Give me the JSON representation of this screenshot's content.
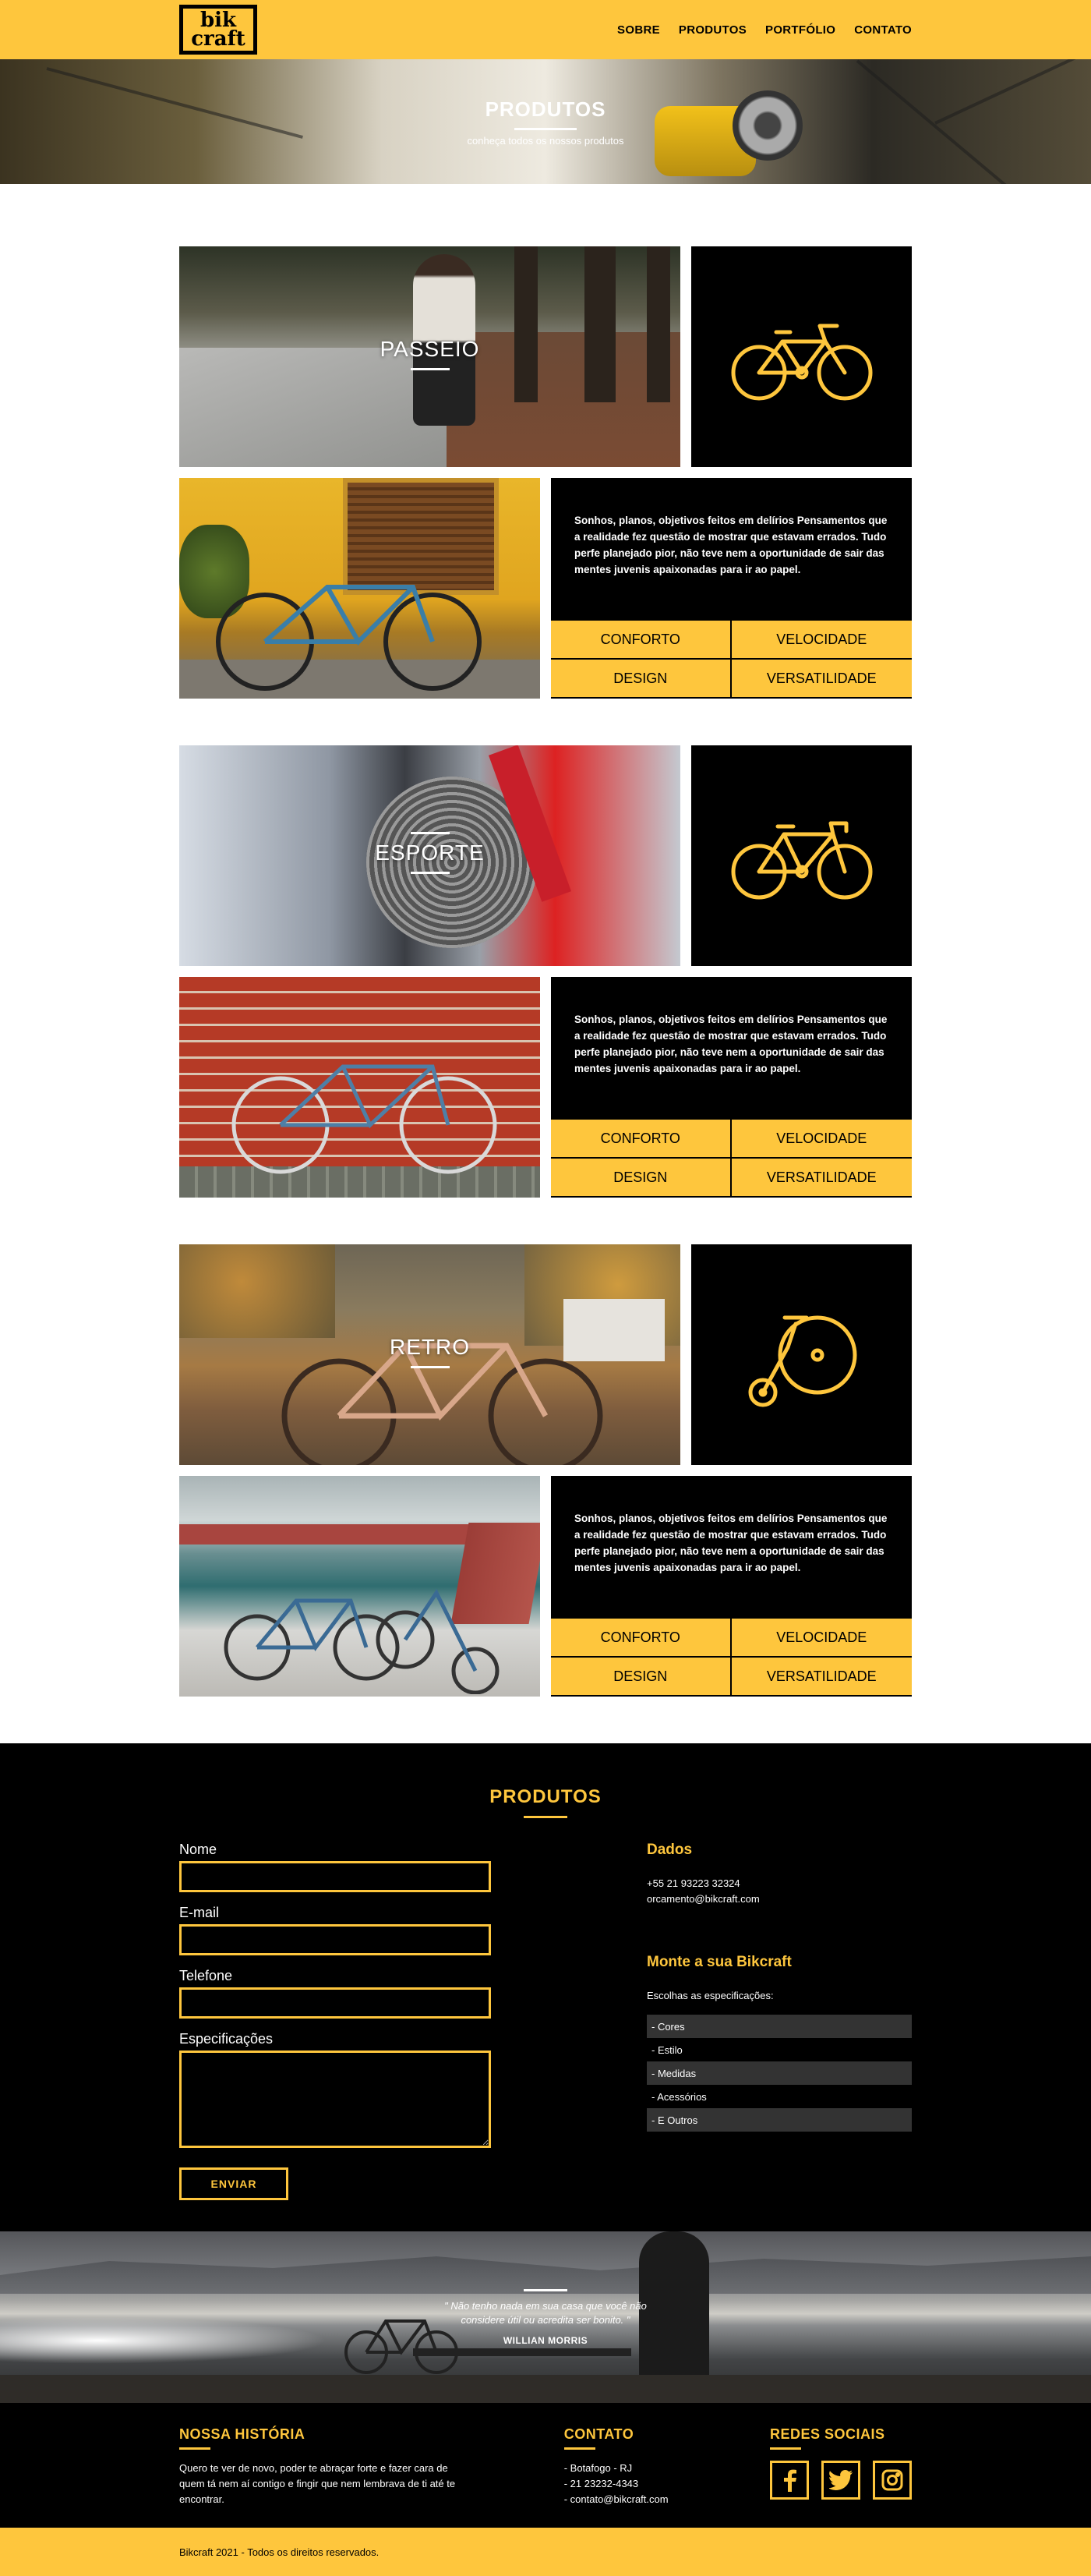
{
  "header": {
    "logo_line1": "bik",
    "logo_line2": "craft",
    "nav": [
      "SOBRE",
      "PRODUTOS",
      "PORTFÓLIO",
      "CONTATO"
    ]
  },
  "hero": {
    "title": "PRODUTOS",
    "subtitle": "conheça todos os nossos produtos"
  },
  "products": [
    {
      "name": "PASSEIO",
      "icon": "bicycle-icon",
      "description": "Sonhos, planos, objetivos feitos em delírios Pensamentos que a realidade fez questão de mostrar que estavam errados. Tudo perfe planejado  pior, não teve  nem a oportunidade de sair das mentes juvenis apaixonadas para ir ao papel.",
      "features": [
        "CONFORTO",
        "VELOCIDADE",
        "DESIGN",
        "VERSATILIDADE"
      ]
    },
    {
      "name": "ESPORTE",
      "icon": "road-bike-icon",
      "description": "Sonhos, planos, objetivos feitos em delírios Pensamentos que a realidade fez questão de mostrar que estavam errados. Tudo perfe planejado  pior, não teve  nem a oportunidade de sair das mentes juvenis apaixonadas para ir ao papel.",
      "features": [
        "CONFORTO",
        "VELOCIDADE",
        "DESIGN",
        "VERSATILIDADE"
      ]
    },
    {
      "name": "RETRO",
      "icon": "penny-farthing-icon",
      "description": "Sonhos, planos, objetivos feitos em delírios Pensamentos que a realidade fez questão de mostrar que estavam errados. Tudo perfe planejado  pior, não teve  nem a oportunidade de sair das mentes juvenis apaixonadas para ir ao papel.",
      "features": [
        "CONFORTO",
        "VELOCIDADE",
        "DESIGN",
        "VERSATILIDADE"
      ]
    }
  ],
  "form": {
    "title": "PRODUTOS",
    "labels": {
      "name": "Nome",
      "email": "E-mail",
      "phone": "Telefone",
      "specs": "Especificações"
    },
    "send": "ENVIAR"
  },
  "contact_data": {
    "title": "Dados",
    "phone": "+55 21 93223 32324",
    "email": "orcamento@bikcraft.com"
  },
  "build": {
    "title": "Monte a sua Bikcraft",
    "intro": "Escolhas as especificações:",
    "items": [
      "- Cores",
      "- Estilo",
      "- Medidas",
      "- Acessórios",
      "- E Outros"
    ]
  },
  "quote": {
    "text": "\" Não tenho nada em sua casa que você não considere útil ou acredita ser bonito. \"",
    "author": "WILLIAN MORRIS"
  },
  "footer": {
    "history_title": "NOSSA HISTÓRIA",
    "history_text": "Quero te ver de novo, poder te abraçar forte e fazer cara de quem tá nem aí contigo e fingir que nem lembrava de ti até te encontrar.",
    "contact_title": "CONTATO",
    "contact_items": [
      "- Botafogo - RJ",
      "- 21 23232-4343",
      "- contato@bikcraft.com"
    ],
    "social_title": "REDES SOCIAIS",
    "social": [
      "facebook-icon",
      "twitter-icon",
      "instagram-icon"
    ],
    "copyright": "Bikcraft 2021 - Todos os direitos reservados."
  },
  "colors": {
    "accent": "#fec63d",
    "dark": "#000000"
  }
}
